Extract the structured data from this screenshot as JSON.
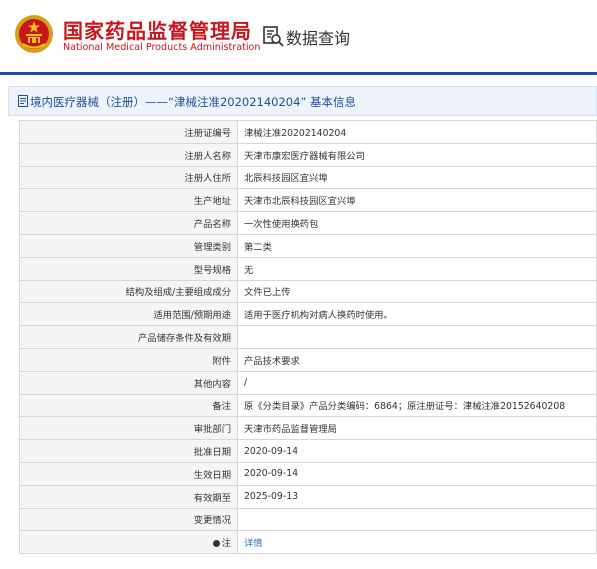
{
  "header": {
    "brand_cn": "国家药品监督管理局",
    "brand_en": "National Medical Products Administration",
    "query_label": "数据查询",
    "accent_color": "#c8161d",
    "divider_color": "#1e4f9c"
  },
  "section": {
    "title": "境内医疗器械（注册）——“津械注准20202140204” 基本信息"
  },
  "rows": [
    {
      "label": "注册证编号",
      "value": "津械注准20202140204"
    },
    {
      "label": "注册人名称",
      "value": "天津市康宏医疗器械有限公司"
    },
    {
      "label": "注册人住所",
      "value": "北辰科技园区宜兴埠"
    },
    {
      "label": "生产地址",
      "value": "天津市北辰科技园区宜兴埠"
    },
    {
      "label": "产品名称",
      "value": "一次性使用换药包"
    },
    {
      "label": "管理类别",
      "value": "第二类"
    },
    {
      "label": "型号规格",
      "value": "无"
    },
    {
      "label": "结构及组成/主要组成成分",
      "value": "文件已上传"
    },
    {
      "label": "适用范围/预期用途",
      "value": "适用于医疗机构对病人换药时使用。"
    },
    {
      "label": "产品储存条件及有效期",
      "value": ""
    },
    {
      "label": "附件",
      "value": "产品技术要求"
    },
    {
      "label": "其他内容",
      "value": "/"
    },
    {
      "label": "备注",
      "value": "原《分类目录》产品分类编码：6864；原注册证号：津械注准20152640208"
    },
    {
      "label": "审批部门",
      "value": "天津市药品监督管理局"
    },
    {
      "label": "批准日期",
      "value": "2020-09-14"
    },
    {
      "label": "生效日期",
      "value": "2020-09-14"
    },
    {
      "label": "有效期至",
      "value": "2025-09-13"
    },
    {
      "label": "变更情况",
      "value": ""
    },
    {
      "label": "注",
      "value": "详情"
    }
  ]
}
